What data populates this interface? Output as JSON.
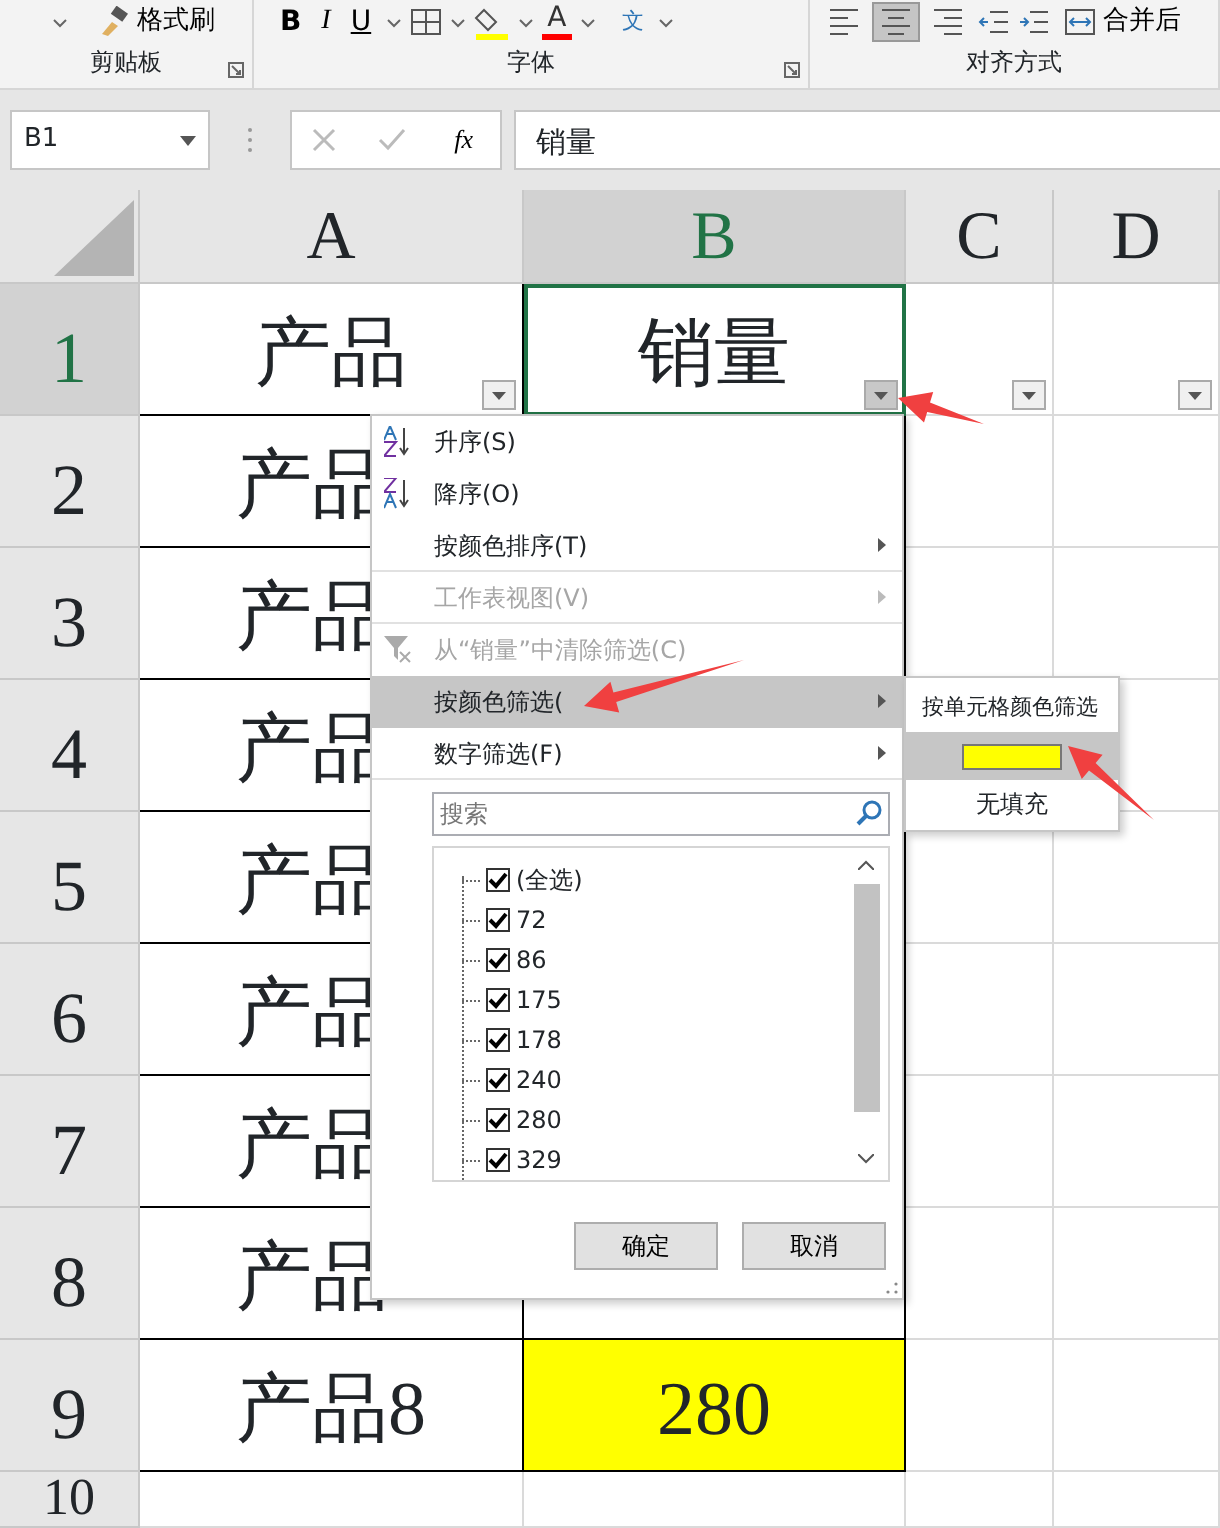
{
  "ribbon": {
    "format_painter": "格式刷",
    "bold": "B",
    "italic": "I",
    "underline": "U",
    "font_color": "A",
    "phonetic_guide": "文",
    "merge": "合并后",
    "alignment": [
      {
        "kind": "left",
        "selected": false
      },
      {
        "kind": "center",
        "selected": true
      },
      {
        "kind": "right",
        "selected": false
      }
    ],
    "groups": [
      {
        "label": "剪贴板"
      },
      {
        "label": "字体"
      },
      {
        "label": "对齐方式"
      }
    ]
  },
  "formula_bar": {
    "name_box": "B1",
    "function_label": "fx",
    "value": "销量"
  },
  "columns": [
    {
      "label": "A",
      "selected": false,
      "filter": true
    },
    {
      "label": "B",
      "selected": true,
      "filter": true
    },
    {
      "label": "C",
      "selected": false,
      "filter": true
    },
    {
      "label": "D",
      "selected": false,
      "filter": true
    }
  ],
  "rows": [
    {
      "header": "1",
      "selected": true,
      "cells": [
        {
          "text": "产品",
          "active": false
        },
        {
          "text": "销量",
          "active": true
        }
      ]
    },
    {
      "header": "2",
      "selected": false,
      "cells": [
        {
          "text": "产品"
        }
      ]
    },
    {
      "header": "3",
      "selected": false,
      "cells": [
        {
          "text": "产品"
        }
      ]
    },
    {
      "header": "4",
      "selected": false,
      "cells": [
        {
          "text": "产品"
        }
      ]
    },
    {
      "header": "5",
      "selected": false,
      "cells": [
        {
          "text": "产品"
        }
      ]
    },
    {
      "header": "6",
      "selected": false,
      "cells": [
        {
          "text": "产品"
        }
      ]
    },
    {
      "header": "7",
      "selected": false,
      "cells": [
        {
          "text": "产品"
        }
      ]
    },
    {
      "header": "8",
      "selected": false,
      "cells": [
        {
          "text": "产品"
        }
      ]
    },
    {
      "header": "9",
      "selected": false,
      "cells": [
        {
          "text": "产品8"
        },
        {
          "text": "280",
          "color": "#ffff00"
        }
      ]
    },
    {
      "header": "10",
      "selected": false
    }
  ],
  "filter_menu": {
    "items": [
      {
        "kind": "sort_asc",
        "label": "升序(S)",
        "disabled": false,
        "submenu": false,
        "selected": false
      },
      {
        "kind": "sort_desc",
        "label": "降序(O)",
        "disabled": false,
        "submenu": false,
        "selected": false
      },
      {
        "kind": "plain",
        "label": "按颜色排序(T)",
        "disabled": false,
        "submenu": true,
        "selected": false
      },
      {
        "kind": "plain",
        "label": "工作表视图(V)",
        "disabled": true,
        "submenu": true,
        "selected": false
      },
      {
        "kind": "clear_filter",
        "label": "从“销量”中清除筛选(C)",
        "disabled": true,
        "submenu": false,
        "selected": false
      },
      {
        "kind": "plain",
        "label": "按颜色筛选(",
        "disabled": false,
        "submenu": true,
        "selected": true
      },
      {
        "kind": "plain",
        "label": "数字筛选(F)",
        "disabled": false,
        "submenu": true,
        "selected": false
      }
    ],
    "search": {
      "placeholder": "搜索"
    },
    "values": [
      {
        "label": "(全选)",
        "checked": true
      },
      {
        "label": "72",
        "checked": true
      },
      {
        "label": "86",
        "checked": true
      },
      {
        "label": "175",
        "checked": true
      },
      {
        "label": "178",
        "checked": true
      },
      {
        "label": "240",
        "checked": true
      },
      {
        "label": "280",
        "checked": true
      },
      {
        "label": "329",
        "checked": true
      }
    ],
    "buttons": [
      "确定",
      "取消"
    ]
  },
  "color_submenu": {
    "title": "按单元格颜色筛选",
    "colors": [
      {
        "color": "#ffff00",
        "selected": true
      }
    ],
    "no_fill": "无填充"
  }
}
